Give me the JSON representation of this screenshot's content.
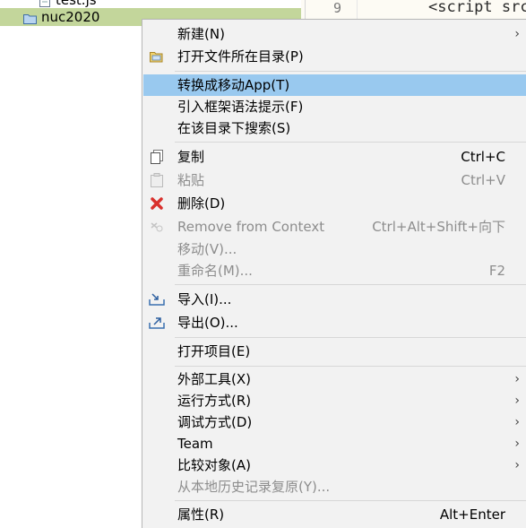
{
  "tree": {
    "partial_label": "test.js",
    "selected_label": "nuc2020",
    "selected_bg": "#c3d69b"
  },
  "editor": {
    "line_number": "9",
    "code_text": "<script src"
  },
  "menu": {
    "highlight_color": "#99c9ef",
    "items": [
      {
        "label": "新建(N)",
        "shortcut": "",
        "arrow": "›"
      },
      {
        "label": "打开文件所在目录(P)",
        "icon": "folder-open-icon"
      },
      {
        "label": "转换成移动App(T)",
        "highlighted": true
      },
      {
        "label": "引入框架语法提示(F)"
      },
      {
        "label": "在该目录下搜索(S)"
      },
      {
        "label": "复制",
        "shortcut": "Ctrl+C",
        "icon": "copy-icon"
      },
      {
        "label": "粘贴",
        "shortcut": "Ctrl+V",
        "icon": "paste-icon",
        "disabled": true
      },
      {
        "label": "删除(D)",
        "icon": "delete-icon"
      },
      {
        "label": "Remove from Context",
        "shortcut": "Ctrl+Alt+Shift+向下",
        "icon": "remove-context-icon",
        "disabled": true
      },
      {
        "label": "移动(V)...",
        "disabled": true
      },
      {
        "label": "重命名(M)...",
        "shortcut": "F2",
        "disabled": true
      },
      {
        "label": "导入(I)...",
        "icon": "import-icon"
      },
      {
        "label": "导出(O)...",
        "icon": "export-icon"
      },
      {
        "label": "打开项目(E)"
      },
      {
        "label": "外部工具(X)",
        "arrow": "›"
      },
      {
        "label": "运行方式(R)",
        "arrow": "›"
      },
      {
        "label": "调试方式(D)",
        "arrow": "›"
      },
      {
        "label": "Team",
        "arrow": "›"
      },
      {
        "label": "比较对象(A)",
        "arrow": "›"
      },
      {
        "label": "从本地历史记录复原(Y)...",
        "disabled": true
      },
      {
        "label": "属性(R)",
        "shortcut": "Alt+Enter"
      }
    ]
  }
}
